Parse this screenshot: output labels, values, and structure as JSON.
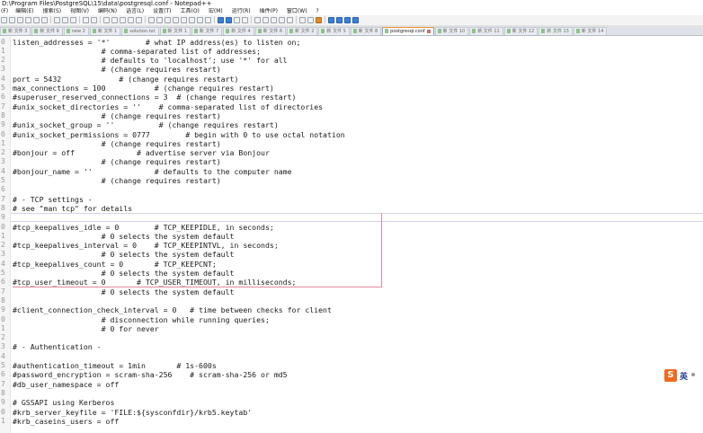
{
  "window": {
    "title": "D:\\Program Files\\PostgreSQL\\15\\data\\postgresql.conf - Notepad++"
  },
  "menu": [
    "(F)",
    "编辑(E)",
    "搜索(S)",
    "视图(V)",
    "编码(N)",
    "语言(L)",
    "设置(T)",
    "工具(O)",
    "宏(M)",
    "运行(R)",
    "插件(P)",
    "窗口(W)",
    "?"
  ],
  "tabs": [
    {
      "label": "新 文件 3"
    },
    {
      "label": "新 文件 9"
    },
    {
      "label": "new 2"
    },
    {
      "label": "新 文件 1"
    },
    {
      "label": "solution.txt"
    },
    {
      "label": "新 文件 1"
    },
    {
      "label": "新 文件 7"
    },
    {
      "label": "新 文件 4"
    },
    {
      "label": "新 文件 6"
    },
    {
      "label": "新 文件 2"
    },
    {
      "label": "新 文件 5"
    },
    {
      "label": "新 文件 8"
    },
    {
      "label": "postgresql.conf",
      "active": true
    },
    {
      "label": "新 文件 10"
    },
    {
      "label": "新 文件 11"
    },
    {
      "label": "新 文件 12"
    },
    {
      "label": "新 文件 13"
    },
    {
      "label": "新 文件 14"
    }
  ],
  "editor": {
    "lines": [
      {
        "n": "0",
        "text": "listen_addresses = '*'        # what IP address(es) to listen on;"
      },
      {
        "n": "1",
        "text": "                    # comma-separated list of addresses;"
      },
      {
        "n": "2",
        "text": "                    # defaults to 'localhost'; use '*' for all"
      },
      {
        "n": "3",
        "text": "                    # (change requires restart)"
      },
      {
        "n": "4",
        "text": "port = 5432             # (change requires restart)"
      },
      {
        "n": "5",
        "text": "max_connections = 100           # (change requires restart)"
      },
      {
        "n": "6",
        "text": "#superuser_reserved_connections = 3  # (change requires restart)"
      },
      {
        "n": "7",
        "text": "#unix_socket_directories = ''    # comma-separated list of directories"
      },
      {
        "n": "8",
        "text": "                    # (change requires restart)"
      },
      {
        "n": "9",
        "text": "#unix_socket_group = ''          # (change requires restart)"
      },
      {
        "n": "0",
        "text": "#unix_socket_permissions = 0777        # begin with 0 to use octal notation"
      },
      {
        "n": "1",
        "text": "                    # (change requires restart)"
      },
      {
        "n": "2",
        "text": "#bonjour = off              # advertise server via Bonjour"
      },
      {
        "n": "3",
        "text": "                    # (change requires restart)"
      },
      {
        "n": "4",
        "text": "#bonjour_name = ''              # defaults to the computer name"
      },
      {
        "n": "5",
        "text": "                    # (change requires restart)"
      },
      {
        "n": "6",
        "text": ""
      },
      {
        "n": "7",
        "text": "# - TCP settings -"
      },
      {
        "n": "8",
        "text": "# see \"man tcp\" for details"
      },
      {
        "n": "9",
        "text": ""
      },
      {
        "n": "0",
        "text": "#tcp_keepalives_idle = 0        # TCP_KEEPIDLE, in seconds;"
      },
      {
        "n": "1",
        "text": "                    # 0 selects the system default"
      },
      {
        "n": "2",
        "text": "#tcp_keepalives_interval = 0    # TCP_KEEPINTVL, in seconds;"
      },
      {
        "n": "3",
        "text": "                    # 0 selects the system default"
      },
      {
        "n": "4",
        "text": "#tcp_keepalives_count = 0       # TCP_KEEPCNT;"
      },
      {
        "n": "5",
        "text": "                    # 0 selects the system default"
      },
      {
        "n": "6",
        "text": "#tcp_user_timeout = 0       # TCP_USER_TIMEOUT, in milliseconds;"
      },
      {
        "n": "7",
        "text": "                    # 0 selects the system default"
      },
      {
        "n": "8",
        "text": ""
      },
      {
        "n": "9",
        "text": "#client_connection_check_interval = 0   # time between checks for client"
      },
      {
        "n": "0",
        "text": "                    # disconnection while running queries;"
      },
      {
        "n": "1",
        "text": "                    # 0 for never"
      },
      {
        "n": "2",
        "text": ""
      },
      {
        "n": "3",
        "text": "# - Authentication -"
      },
      {
        "n": "4",
        "text": ""
      },
      {
        "n": "5",
        "text": "#authentication_timeout = 1min       # 1s-600s"
      },
      {
        "n": "6",
        "text": "#password_encryption = scram-sha-256    # scram-sha-256 or md5"
      },
      {
        "n": "7",
        "text": "#db_user_namespace = off"
      },
      {
        "n": "8",
        "text": ""
      },
      {
        "n": "9",
        "text": "# GSSAPI using Kerberos"
      },
      {
        "n": "0",
        "text": "#krb_server_keyfile = 'FILE:${sysconfdir}/krb5.keytab'"
      },
      {
        "n": "1",
        "text": "#krb_caseins_users = off"
      }
    ],
    "current_line_index": 19
  },
  "ime": {
    "logo": "S",
    "label": "英"
  }
}
